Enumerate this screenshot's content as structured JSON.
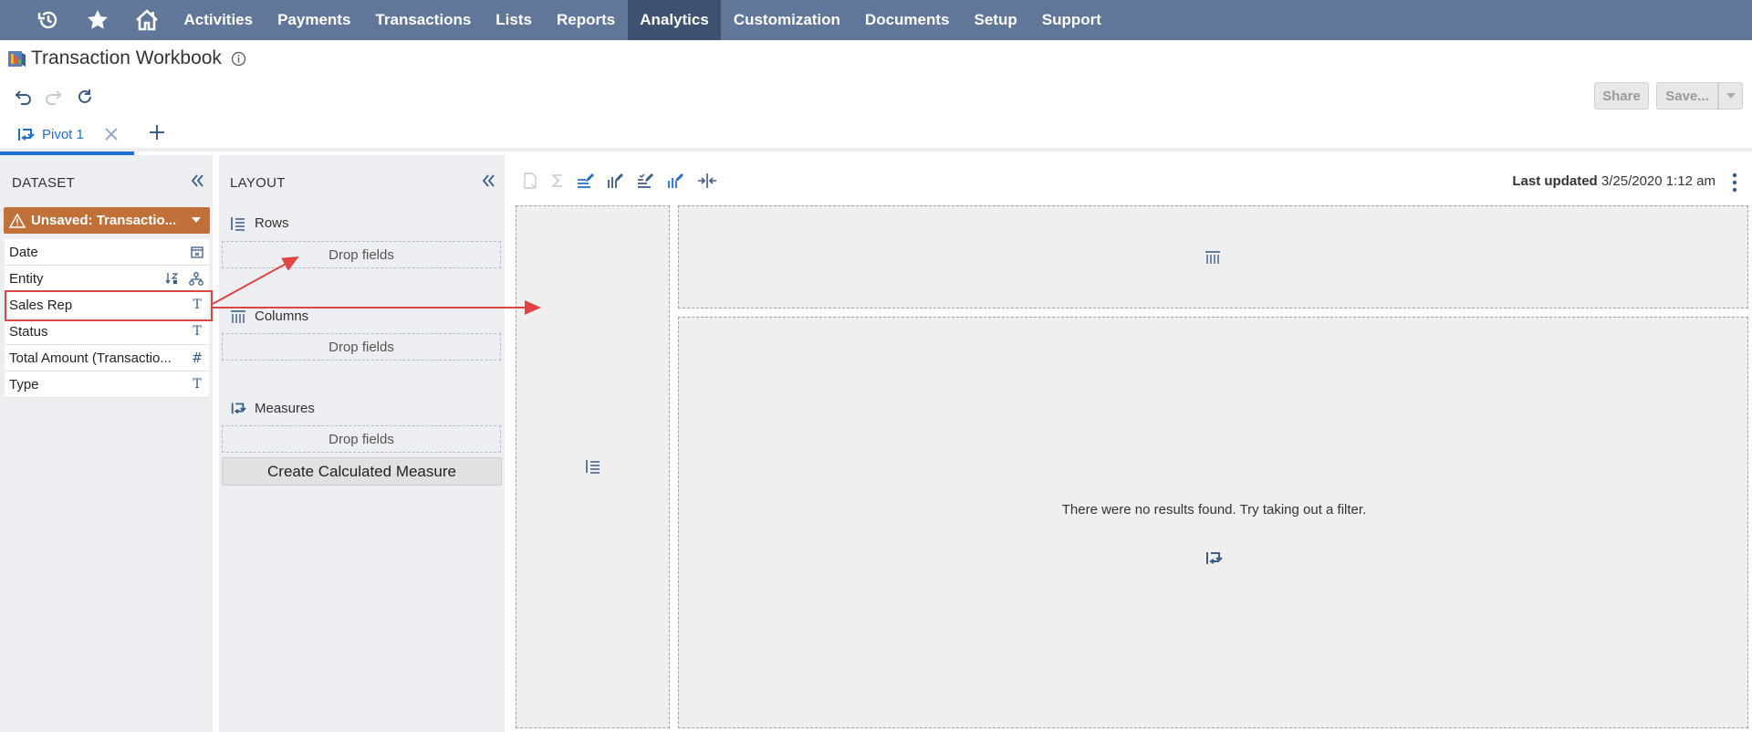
{
  "nav": {
    "items": [
      "Activities",
      "Payments",
      "Transactions",
      "Lists",
      "Reports",
      "Analytics",
      "Customization",
      "Documents",
      "Setup",
      "Support"
    ],
    "active": "Analytics",
    "icons": [
      "recent-history-icon",
      "star-icon",
      "home-icon"
    ]
  },
  "page": {
    "title": "Transaction Workbook"
  },
  "buttons": {
    "share": "Share",
    "save": "Save..."
  },
  "tabs": {
    "active_label": "Pivot 1"
  },
  "dataset": {
    "heading": "DATASET",
    "selected": "Unsaved: Transactio...",
    "fields": [
      {
        "label": "Date",
        "icon": "calendar-icon"
      },
      {
        "label": "Entity",
        "icon": "hierarchy-icon"
      },
      {
        "label": "Sales Rep",
        "icon": "text-type-icon"
      },
      {
        "label": "Status",
        "icon": "text-type-icon"
      },
      {
        "label": "Total Amount (Transactio...",
        "icon": "number-type-icon"
      },
      {
        "label": "Type",
        "icon": "text-type-icon"
      }
    ]
  },
  "layout": {
    "heading": "LAYOUT",
    "rows_label": "Rows",
    "columns_label": "Columns",
    "measures_label": "Measures",
    "drop_text": "Drop fields",
    "calc_button": "Create Calculated Measure"
  },
  "pivot": {
    "last_updated_label": "Last updated",
    "last_updated_value": "3/25/2020 1:12 am",
    "empty_message": "There were no results found. Try taking out a filter."
  },
  "colors": {
    "nav_bg": "#607799",
    "nav_active": "#3e5170",
    "accent": "#1f6fd1",
    "dataset_btn": "#c07039",
    "annotation": "#e04545"
  }
}
